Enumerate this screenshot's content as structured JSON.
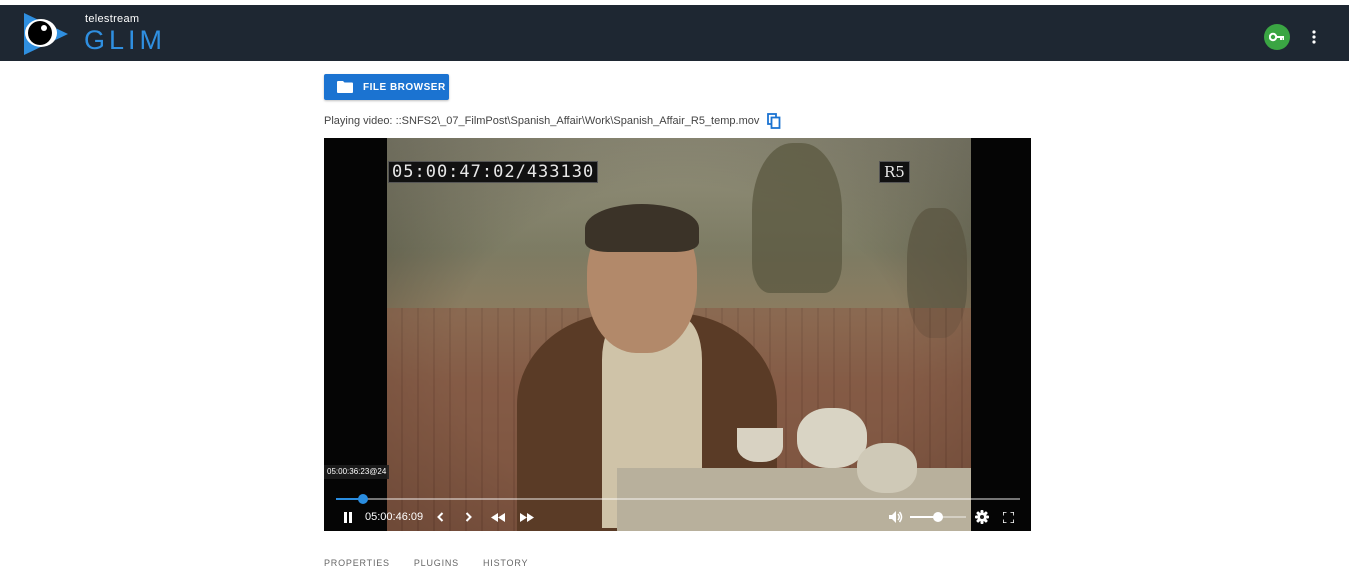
{
  "header": {
    "brand_small": "telestream",
    "brand_large": "GLIM",
    "colors": {
      "bar": "#1e2732",
      "brand": "#2f8fe0",
      "key_button": "#3aa543"
    },
    "icons": {
      "logo": "telestream-logo-icon",
      "key": "key-icon",
      "menu": "more-vert-icon"
    }
  },
  "toolbar": {
    "file_browser_label": "FILE BROWSER",
    "file_browser_icon": "folder-icon",
    "button_color": "#1b73d1"
  },
  "playing": {
    "prefix": "Playing video:",
    "path": "::SNFS2\\_07_FilmPost\\Spanish_Affair\\Work\\Spanish_Affair_R5_temp.mov",
    "copy_icon": "copy-icon"
  },
  "video": {
    "burned_timecode": "05:00:47:02/433130",
    "reel": "R5",
    "hover_timecode": "05:00:36:23@24",
    "current_time": "05:00:46:09",
    "progress_fraction": 0.04,
    "buffered_fraction": 0.025,
    "volume_fraction": 0.5,
    "controls": {
      "pause": "pause-icon",
      "prev_frame": "chevron-left-icon",
      "next_frame": "chevron-right-icon",
      "rewind": "rewind-icon",
      "fast_forward": "fast-forward-icon",
      "volume": "volume-icon",
      "settings": "settings-icon",
      "fullscreen": "fullscreen-icon"
    }
  },
  "tabs": [
    {
      "label": "PROPERTIES"
    },
    {
      "label": "PLUGINS"
    },
    {
      "label": "HISTORY"
    }
  ]
}
